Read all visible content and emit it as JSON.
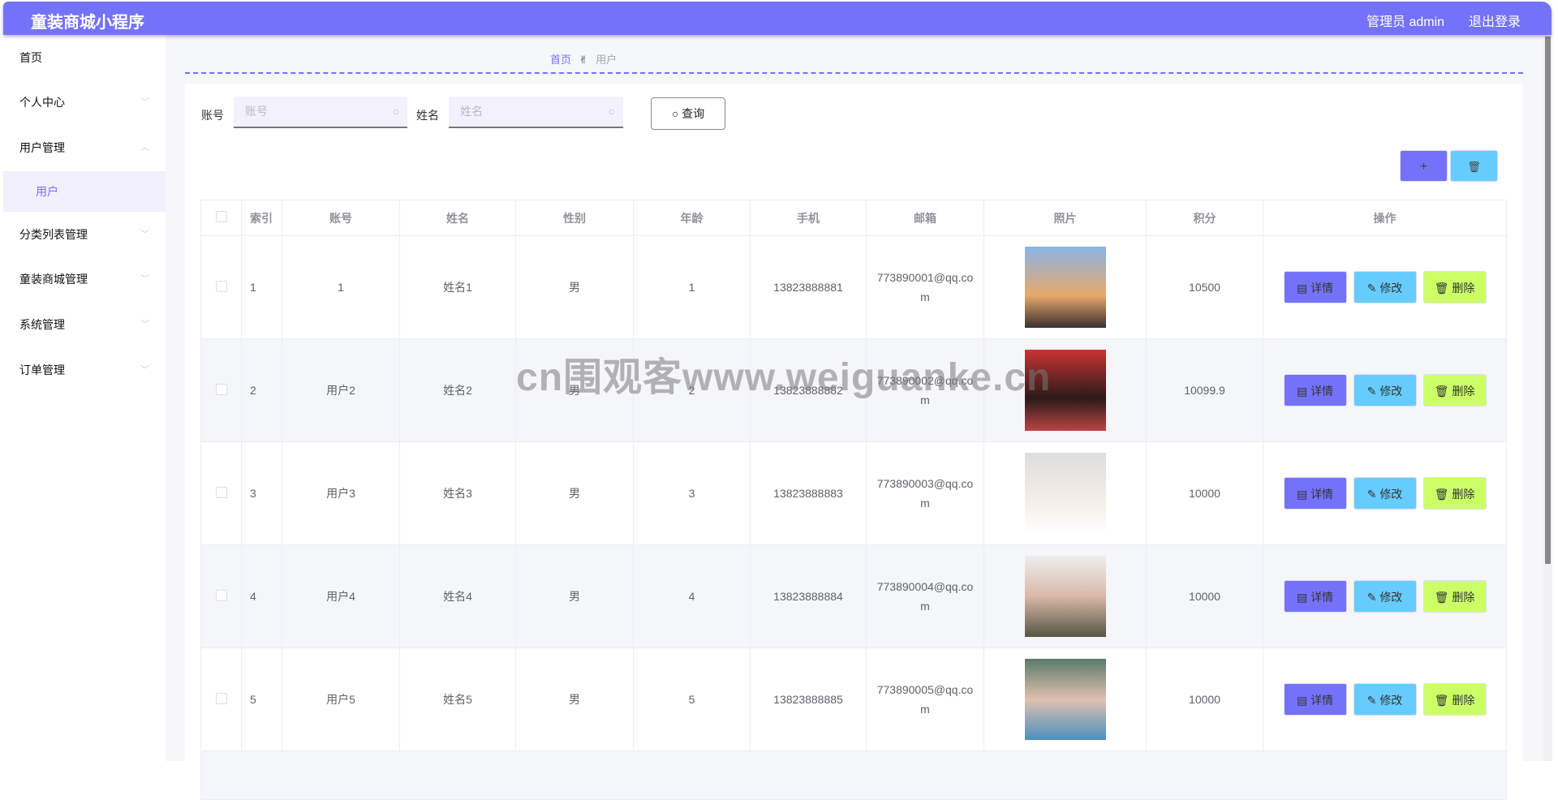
{
  "header": {
    "title": "童装商城小程序",
    "user": "管理员 admin",
    "logout": "退出登录"
  },
  "sidebar": {
    "items": [
      {
        "label": "首页",
        "chevron": ""
      },
      {
        "label": "个人中心",
        "chevron": "﹀"
      },
      {
        "label": "用户管理",
        "chevron": "︿"
      },
      {
        "label": "用户",
        "chevron": ""
      },
      {
        "label": "分类列表管理",
        "chevron": "﹀"
      },
      {
        "label": "童装商城管理",
        "chevron": "﹀"
      },
      {
        "label": "系统管理",
        "chevron": "﹀"
      },
      {
        "label": "订单管理",
        "chevron": "﹀"
      }
    ]
  },
  "breadcrumb": {
    "home": "首页",
    "sep": "✌",
    "current": "用户"
  },
  "search": {
    "account_label": "账号",
    "account_placeholder": "账号",
    "name_label": "姓名",
    "name_placeholder": "姓名",
    "query_button": "查询"
  },
  "toolbar": {
    "add": "+",
    "delete": "🗑"
  },
  "table": {
    "headers": [
      "索引",
      "账号",
      "姓名",
      "性别",
      "年龄",
      "手机",
      "邮箱",
      "照片",
      "积分",
      "操作"
    ],
    "actions": {
      "detail": "详情",
      "edit": "修改",
      "delete": "删除"
    },
    "rows": [
      {
        "index": "1",
        "account": "1",
        "name": "姓名1",
        "gender": "男",
        "age": "1",
        "phone": "13823888881",
        "email": "773890001@qq.com",
        "points": "10500"
      },
      {
        "index": "2",
        "account": "用户2",
        "name": "姓名2",
        "gender": "男",
        "age": "2",
        "phone": "13823888882",
        "email": "773890002@qq.com",
        "points": "10099.9"
      },
      {
        "index": "3",
        "account": "用户3",
        "name": "姓名3",
        "gender": "男",
        "age": "3",
        "phone": "13823888883",
        "email": "773890003@qq.com",
        "points": "10000"
      },
      {
        "index": "4",
        "account": "用户4",
        "name": "姓名4",
        "gender": "男",
        "age": "4",
        "phone": "13823888884",
        "email": "773890004@qq.com",
        "points": "10000"
      },
      {
        "index": "5",
        "account": "用户5",
        "name": "姓名5",
        "gender": "男",
        "age": "5",
        "phone": "13823888885",
        "email": "773890005@qq.com",
        "points": "10000"
      }
    ]
  },
  "watermark": "cn围观客www.weiguanke.cn",
  "colors": {
    "primary": "#7572fa",
    "info": "#66ccff",
    "danger": "#ccff66"
  }
}
